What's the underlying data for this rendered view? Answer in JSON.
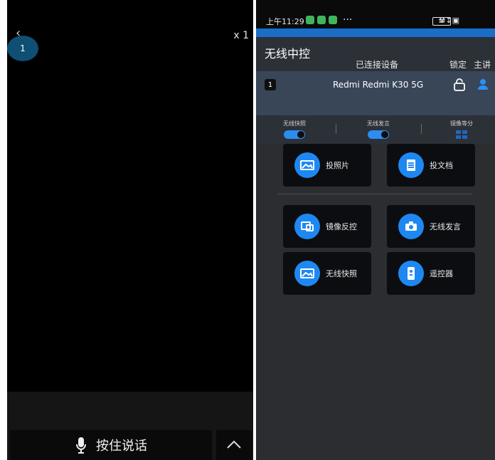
{
  "left_panel": {
    "back_icon": "chevron-left",
    "page_number": "1",
    "zoom": "x 1",
    "hold_to_talk": "按住说话",
    "expand_icon": "chevron-up"
  },
  "right_panel": {
    "status_bar": {
      "time": "上午11:29",
      "badges": [
        "green",
        "green",
        "green"
      ],
      "dots": "···",
      "battery": "34"
    },
    "header": {
      "title": "无线中控",
      "connected_devices": "已连接设备",
      "lock_label": "锁定",
      "presenter_label": "主讲"
    },
    "device": {
      "index": "1",
      "name": "Redmi Redmi K30 5G"
    },
    "controls": {
      "wireless_snapshot_label": "无线快照",
      "wireless_speech_label": "无线发言",
      "mirror_split_label": "镜像等分"
    },
    "menu": {
      "cards": [
        {
          "label": "投照片",
          "icon": "image-icon"
        },
        {
          "label": "投文档",
          "icon": "document-icon"
        },
        {
          "label": "镜像反控",
          "icon": "mirror-control-icon"
        },
        {
          "label": "无线发言",
          "icon": "camera-icon"
        },
        {
          "label": "无线快照",
          "icon": "snapshot-icon"
        },
        {
          "label": "遥控器",
          "icon": "remote-icon"
        }
      ]
    }
  },
  "colors": {
    "accent_blue": "#1e88f2",
    "panel_dark": "#2b2d31",
    "card_dark": "#0c0d10"
  }
}
